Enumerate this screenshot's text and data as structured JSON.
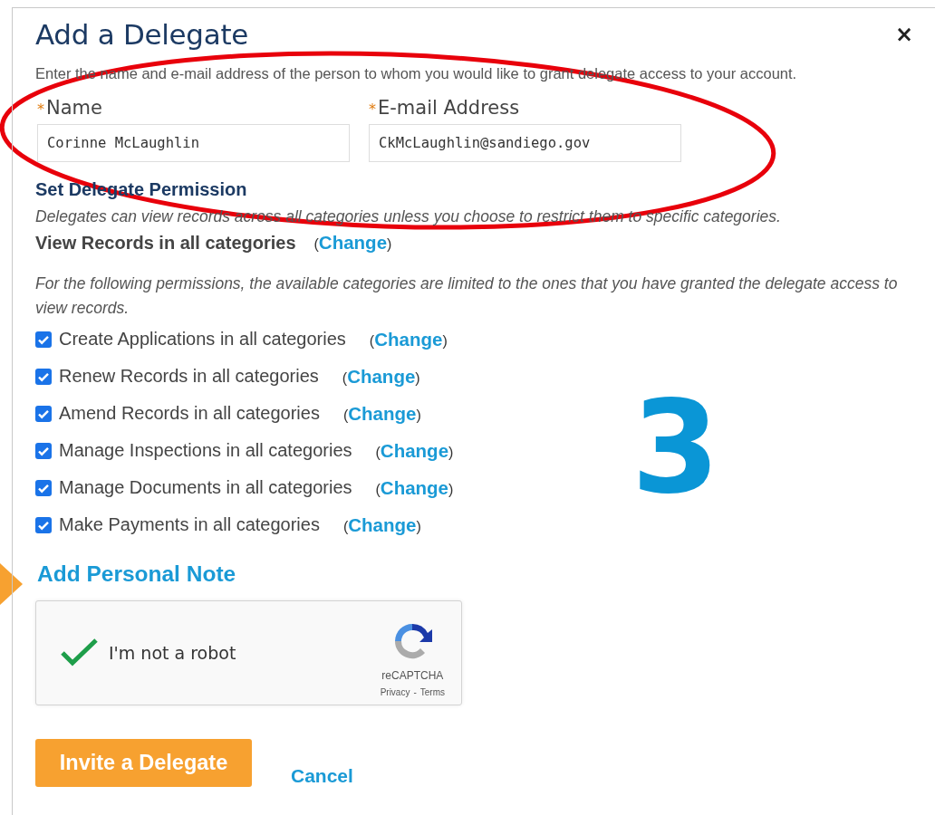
{
  "dialog": {
    "title": "Add a Delegate",
    "close": "×",
    "intro": "Enter the name and e-mail address of the person to whom you would like to grant delegate access to your account.",
    "fields": [
      {
        "required": "*",
        "label": "Name",
        "value": "Corinne McLaughlin"
      },
      {
        "required": "*",
        "label": "E-mail Address",
        "value": "CkMcLaughlin@sandiego.gov"
      }
    ],
    "permission_heading": "Set Delegate Permission",
    "permission_note": "Delegates can view records across all categories unless you choose to restrict them to specific categories.",
    "view_records": {
      "label": "View Records in all categories",
      "before": "(",
      "link": "Change",
      "after": ")"
    },
    "permissions_note": "For the following permissions, the available categories are limited to the ones that you have granted the delegate access to view records.",
    "permissions": [
      {
        "label": "Create Applications in all categories",
        "checked": true,
        "before": "(",
        "link": "Change",
        "after": ")"
      },
      {
        "label": "Renew Records in all categories",
        "checked": true,
        "before": "(",
        "link": "Change",
        "after": ")"
      },
      {
        "label": "Amend Records in all categories",
        "checked": true,
        "before": "(",
        "link": "Change",
        "after": ")"
      },
      {
        "label": "Manage Inspections in all categories",
        "checked": true,
        "before": "(",
        "link": "Change",
        "after": ")"
      },
      {
        "label": "Manage Documents in all categories",
        "checked": true,
        "before": "(",
        "link": "Change",
        "after": ")"
      },
      {
        "label": "Make Payments in all categories",
        "checked": true,
        "before": "(",
        "link": "Change",
        "after": ")"
      }
    ],
    "personal_note_link": "Add Personal Note",
    "captcha": {
      "checked": true,
      "label": "I'm not a robot",
      "brand": "reCAPTCHA",
      "privacy": "Privacy",
      "separator": "-",
      "terms": "Terms"
    },
    "buttons": {
      "primary": "Invite a Delegate",
      "cancel": "Cancel"
    }
  },
  "annotations": [
    {
      "kind": "ellipse",
      "color": "#e8000b"
    },
    {
      "kind": "number",
      "text": "3",
      "color": "#0a96d6"
    },
    {
      "kind": "arrow",
      "color": "#f7a130"
    }
  ]
}
